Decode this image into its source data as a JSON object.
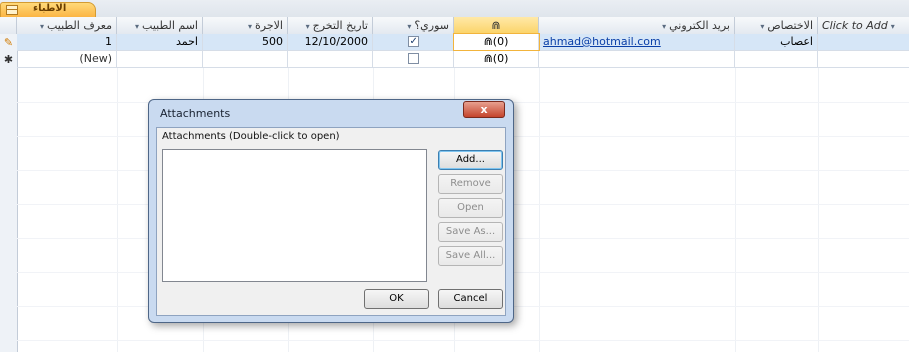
{
  "tab": {
    "label": "الاطباء"
  },
  "columns": [
    {
      "key": "doctor_id",
      "label": "معرف الطبيب",
      "arrow": "▾"
    },
    {
      "key": "doctor_name",
      "label": "اسم الطبيب",
      "arrow": "▾"
    },
    {
      "key": "fee",
      "label": "الاجرة",
      "arrow": "▾"
    },
    {
      "key": "grad_date",
      "label": "تاريخ التخرج",
      "arrow": "▾"
    },
    {
      "key": "syrian",
      "label": "سوري؟",
      "arrow": "▾"
    },
    {
      "key": "attachments",
      "label": "⋒",
      "arrow": ""
    },
    {
      "key": "email",
      "label": "بريد الكتروني",
      "arrow": "▾"
    },
    {
      "key": "specialty",
      "label": "الاختصاص",
      "arrow": "▾"
    },
    {
      "key": "add",
      "label": "Click to Add",
      "arrow": "▾"
    }
  ],
  "rows": [
    {
      "indicator": "✎",
      "doctor_id": "1",
      "doctor_name": "احمد",
      "fee": "500",
      "grad_date": "12/10/2000",
      "syrian": true,
      "attachments": "⋒(0)",
      "email": "ahmad@hotmail.com",
      "specialty": "اعصاب"
    },
    {
      "indicator": "✱",
      "doctor_id": "(New)",
      "attachments": "⋒(0)",
      "syrian": false
    }
  ],
  "dialog": {
    "title": "Attachments",
    "close": "x",
    "caption": "Attachments (Double-click to open)",
    "buttons": {
      "add": "Add...",
      "remove": "Remove",
      "open": "Open",
      "save_as": "Save As...",
      "save_all": "Save All...",
      "ok": "OK",
      "cancel": "Cancel"
    }
  }
}
